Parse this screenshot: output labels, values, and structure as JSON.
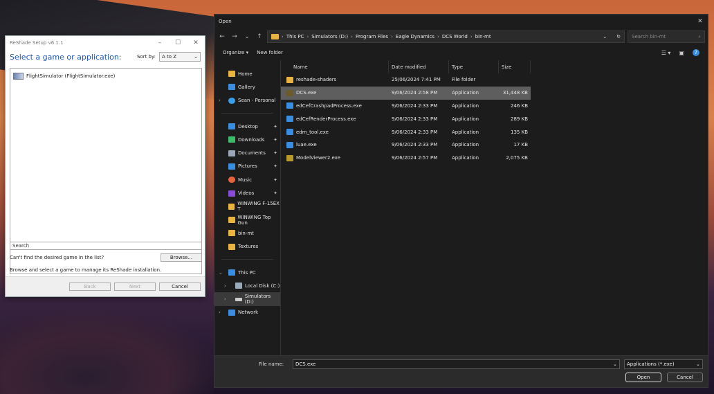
{
  "reshade": {
    "title": "ReShade Setup v6.1.1",
    "heading": "Select a game or application:",
    "sort_label": "Sort by:",
    "sort_value": "A to Z",
    "list_items": [
      "FlightSimulator (FlightSimulator.exe)"
    ],
    "search_placeholder": "Search",
    "not_found_text": "Can't find the desired game in the list?",
    "browse_label": "Browse...",
    "hint_text": "Browse and select a game to manage its ReShade installation.",
    "back_label": "Back",
    "next_label": "Next",
    "cancel_label": "Cancel"
  },
  "dialog": {
    "title": "Open",
    "breadcrumbs": [
      "This PC",
      "Simulators (D:)",
      "Program Files",
      "Eagle Dynamics",
      "DCS World",
      "bin-mt"
    ],
    "search_placeholder": "Search bin-mt",
    "organize_label": "Organize",
    "new_folder_label": "New folder",
    "nav_items": [
      {
        "label": "Home",
        "icon": "home-icon",
        "color": "#e8b33e"
      },
      {
        "label": "Gallery",
        "icon": "gallery-icon",
        "color": "#3b8de0"
      },
      {
        "label": "Sean - Personal",
        "icon": "cloud-icon",
        "color": "#3b9de8"
      },
      {
        "label": "Desktop",
        "icon": "desktop-icon",
        "color": "#3b8de0"
      },
      {
        "label": "Downloads",
        "icon": "download-icon",
        "color": "#3dbb6a"
      },
      {
        "label": "Documents",
        "icon": "documents-icon",
        "color": "#9aa5b8"
      },
      {
        "label": "Pictures",
        "icon": "pictures-icon",
        "color": "#3b8de0"
      },
      {
        "label": "Music",
        "icon": "music-icon",
        "color": "#e8643e"
      },
      {
        "label": "Videos",
        "icon": "videos-icon",
        "color": "#8a4bd6"
      },
      {
        "label": "WINWING F-15EX T",
        "icon": "folder-icon",
        "color": "#e8b33e"
      },
      {
        "label": "WINWING Top Gun",
        "icon": "folder-icon",
        "color": "#e8b33e"
      },
      {
        "label": "bin-mt",
        "icon": "folder-icon",
        "color": "#e8b33e"
      },
      {
        "label": "Textures",
        "icon": "folder-icon",
        "color": "#e8b33e"
      },
      {
        "label": "This PC",
        "icon": "computer-icon",
        "color": "#3b8de0"
      },
      {
        "label": "Local Disk (C:)",
        "icon": "drive-icon",
        "color": "#9ab"
      },
      {
        "label": "Simulators (D:)",
        "icon": "drive-icon",
        "color": "#ccc"
      },
      {
        "label": "Network",
        "icon": "network-icon",
        "color": "#3b8de0"
      }
    ],
    "columns": {
      "name": "Name",
      "date": "Date modified",
      "type": "Type",
      "size": "Size"
    },
    "files": [
      {
        "name": "reshade-shaders",
        "date": "25/06/2024 7:41 PM",
        "type": "File folder",
        "size": "",
        "icon": "folder-icon",
        "color": "#e8b33e"
      },
      {
        "name": "DCS.exe",
        "date": "9/06/2024 2:58 PM",
        "type": "Application",
        "size": "31,448 KB",
        "icon": "dcs-app-icon",
        "color": "#6b5a2a"
      },
      {
        "name": "edCefCrashpadProcess.exe",
        "date": "9/06/2024 2:33 PM",
        "type": "Application",
        "size": "246 KB",
        "icon": "app-icon",
        "color": "#3b8de0"
      },
      {
        "name": "edCefRenderProcess.exe",
        "date": "9/06/2024 2:33 PM",
        "type": "Application",
        "size": "289 KB",
        "icon": "app-icon",
        "color": "#3b8de0"
      },
      {
        "name": "edm_tool.exe",
        "date": "9/06/2024 2:33 PM",
        "type": "Application",
        "size": "135 KB",
        "icon": "app-icon",
        "color": "#3b8de0"
      },
      {
        "name": "luae.exe",
        "date": "9/06/2024 2:33 PM",
        "type": "Application",
        "size": "17 KB",
        "icon": "app-icon",
        "color": "#3b8de0"
      },
      {
        "name": "ModelViewer2.exe",
        "date": "9/06/2024 2:57 PM",
        "type": "Application",
        "size": "2,075 KB",
        "icon": "modelviewer-icon",
        "color": "#b89a2a"
      }
    ],
    "file_name_label": "File name:",
    "file_name_value": "DCS.exe",
    "filter_value": "Applications (*.exe)",
    "open_label": "Open",
    "cancel_label": "Cancel"
  }
}
